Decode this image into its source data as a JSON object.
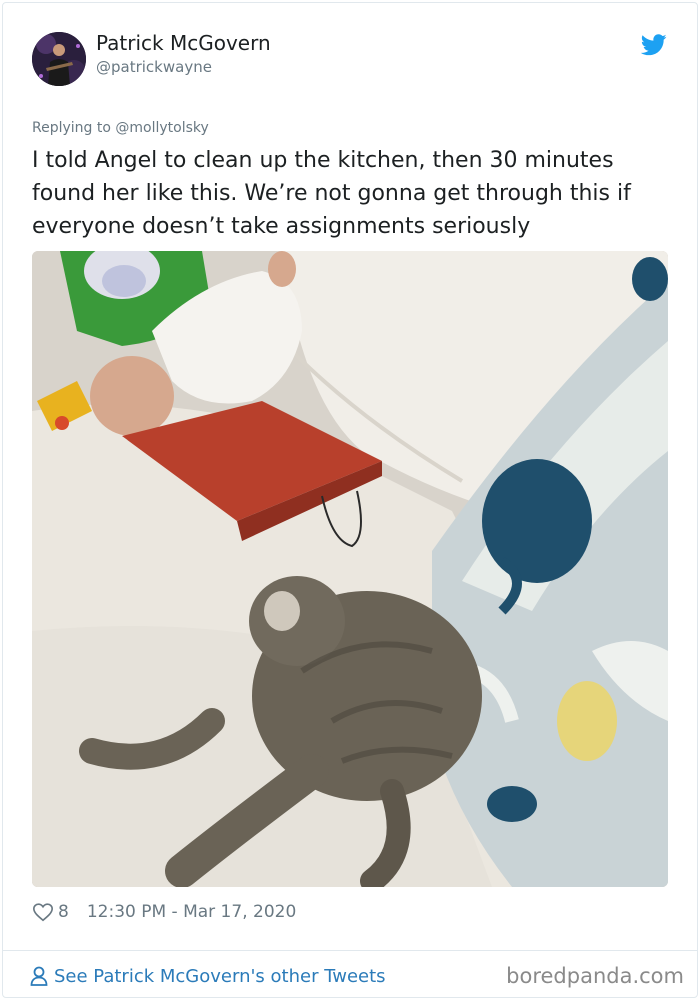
{
  "tweet": {
    "author_name": "Patrick McGovern",
    "author_handle": "@patrickwayne",
    "replying_prefix": "Replying to ",
    "replying_to": "@mollytolsky",
    "text": "I told Angel to clean up the kitchen, then 30 minutes found her like this. We’re not gonna get through this if everyone doesn’t take assignments seriously",
    "like_count": "8",
    "timestamp": "12:30 PM - Mar 17, 2020"
  },
  "footer": {
    "link_label": "See Patrick McGovern's other Tweets",
    "watermark": "boredpanda.com"
  },
  "colors": {
    "link": "#2b7bb9",
    "secondary_text": "#697882",
    "twitter_blue": "#1da1f2",
    "border": "#e1e8ed"
  },
  "icons": [
    "twitter-bird-icon",
    "heart-icon",
    "person-icon"
  ]
}
